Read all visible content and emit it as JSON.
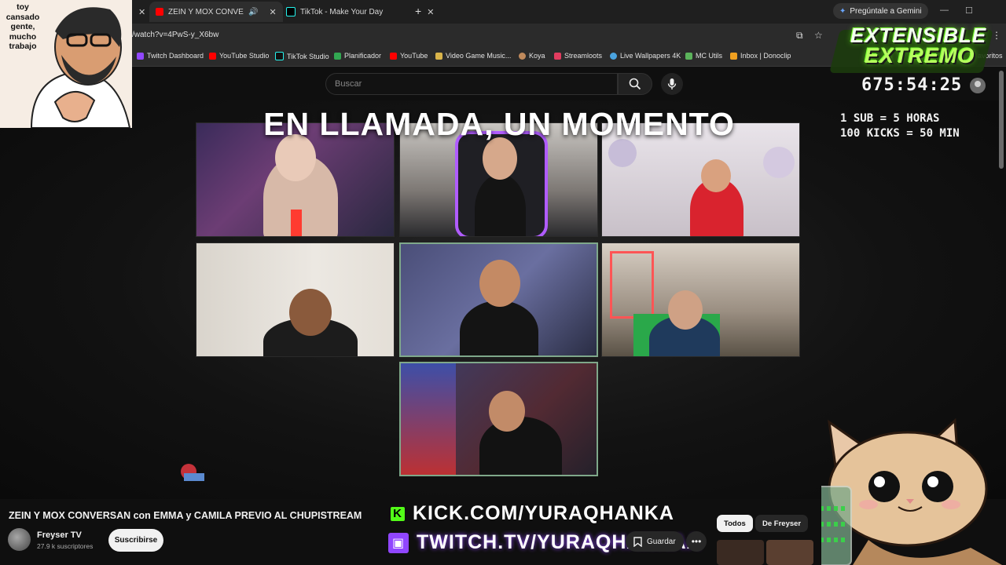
{
  "browser": {
    "tabs": [
      {
        "title": "ZEIN Y MOX CONVERSAN",
        "active": true
      },
      {
        "title": "TikTok - Make Your Day",
        "active": false
      }
    ],
    "gemini_label": "Pregúntale a Gemini",
    "url": "/watch?v=4PwS-y_X6bw",
    "bookmarks": [
      "Twitch Dashboard",
      "YouTube Studio",
      "TikTok Studio",
      "Planificador",
      "YouTube",
      "Video Game Music...",
      "Koya",
      "Streamloots",
      "Live Wallpapers 4K",
      "MC Utils",
      "Inbox | Donoclip"
    ],
    "bookmarks_overflow": "avoritos"
  },
  "youtube": {
    "search_placeholder": "Buscar",
    "video_title": "ZEIN Y MOX CONVERSAN con EMMA y CAMILA PREVIO AL CHUPISTREAM",
    "channel_name": "Freyser TV",
    "channel_subs": "27.9 k suscriptores",
    "subscribe_label": "Suscribirse",
    "save_label": "Guardar",
    "chips": [
      "Todos",
      "De Freyser"
    ]
  },
  "overlay": {
    "mascot_speech": [
      "toy",
      "cansado",
      "gente,",
      "mucho",
      "trabajo"
    ],
    "logo_line1": "EXTENSIBLE",
    "logo_line2": "EXTREMO",
    "timer": "675:54:25",
    "rules": [
      "1 SUB = 5 HORAS",
      "100 KICKS = 50 MIN"
    ],
    "call_title": "EN LLAMADA, UN MOMENTO",
    "kick_url": "KICK.COM/YURAQHANKA",
    "twitch_url": "TWITCH.TV/YURAQHANKAA"
  },
  "colors": {
    "kick_green": "#53fc18",
    "twitch_purple": "#9147ff",
    "youtube_red": "#ff0000",
    "logo_green": "#7cff34"
  }
}
